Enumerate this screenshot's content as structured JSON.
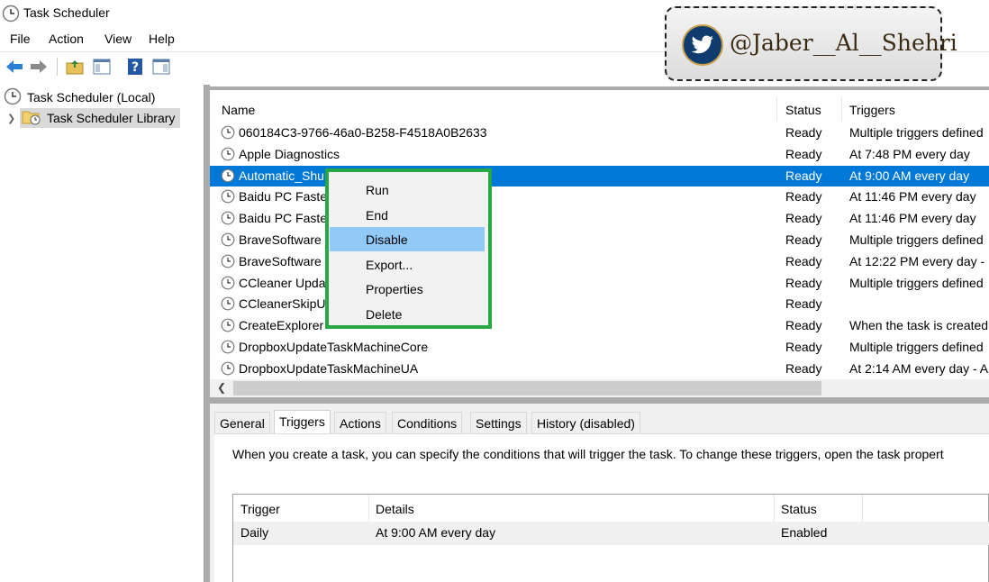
{
  "window": {
    "title": "Task Scheduler"
  },
  "menu": [
    "File",
    "Action",
    "View",
    "Help"
  ],
  "tree": {
    "root": "Task Scheduler (Local)",
    "library": "Task Scheduler Library"
  },
  "task_list": {
    "columns": [
      "Name",
      "Status",
      "Triggers"
    ],
    "rows": [
      {
        "name": "060184C3-9766-46a0-B258-F4518A0B2633",
        "status": "Ready",
        "triggers": "Multiple triggers defined"
      },
      {
        "name": "Apple Diagnostics",
        "status": "Ready",
        "triggers": "At 7:48 PM every day"
      },
      {
        "name": "Automatic_Shu",
        "status": "Ready",
        "triggers": "At 9:00 AM every day"
      },
      {
        "name": "Baidu PC Faste",
        "status": "Ready",
        "triggers": "At 11:46 PM every day"
      },
      {
        "name": "Baidu PC Faste",
        "status": "Ready",
        "triggers": "At 11:46 PM every day"
      },
      {
        "name": "BraveSoftware",
        "status": "Ready",
        "triggers": "Multiple triggers defined"
      },
      {
        "name": "BraveSoftware",
        "status": "Ready",
        "triggers": "At 12:22 PM every day -"
      },
      {
        "name": "CCleaner Upda",
        "status": "Ready",
        "triggers": "Multiple triggers defined"
      },
      {
        "name": "CCleanerSkipU",
        "status": "Ready",
        "triggers": ""
      },
      {
        "name": "CreateExplorer",
        "status": "Ready",
        "triggers": "When the task is created"
      },
      {
        "name": "DropboxUpdateTaskMachineCore",
        "status": "Ready",
        "triggers": "Multiple triggers defined"
      },
      {
        "name": "DropboxUpdateTaskMachineUA",
        "status": "Ready",
        "triggers": "At 2:14 AM every day - A"
      }
    ],
    "selected_index": 2
  },
  "context_menu": {
    "items": [
      "Run",
      "End",
      "Disable",
      "Export...",
      "Properties",
      "Delete"
    ],
    "highlighted": "Disable"
  },
  "detail_tabs": [
    "General",
    "Triggers",
    "Actions",
    "Conditions",
    "Settings",
    "History (disabled)"
  ],
  "active_tab": "Triggers",
  "triggers_tab": {
    "description": "When you create a task, you can specify the conditions that will trigger the task.  To change these triggers, open the task propert",
    "columns": [
      "Trigger",
      "Details",
      "Status"
    ],
    "rows": [
      {
        "trigger": "Daily",
        "details": "At 9:00 AM every day",
        "status": "Enabled"
      }
    ]
  },
  "watermark": {
    "handle": "@Jaber__Al__Shehri"
  },
  "colors": {
    "selection": "#0078d7",
    "menu_hover": "#91c9f7",
    "highlight_border": "#27a844"
  }
}
